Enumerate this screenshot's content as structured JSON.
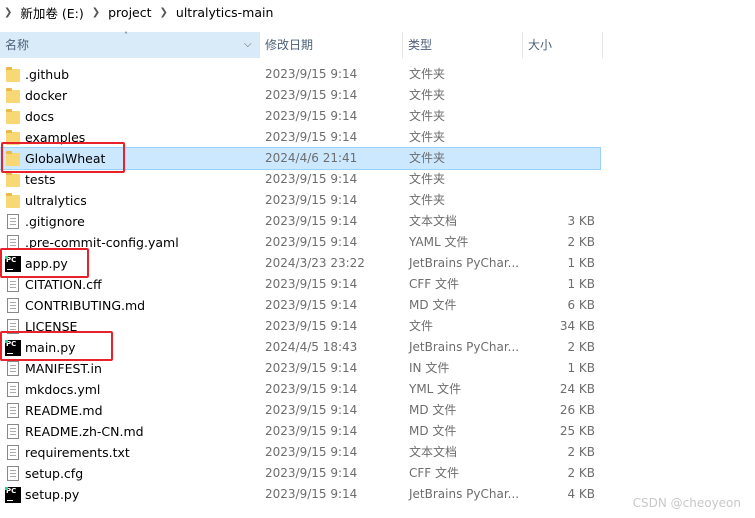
{
  "breadcrumb": [
    "新加卷 (E:)",
    "project",
    "ultralytics-main"
  ],
  "columns": {
    "name": "名称",
    "date": "修改日期",
    "type": "类型",
    "size": "大小"
  },
  "files": [
    {
      "name": ".github",
      "date": "2023/9/15 9:14",
      "type": "文件夹",
      "size": "",
      "icon": "folder-icon"
    },
    {
      "name": "docker",
      "date": "2023/9/15 9:14",
      "type": "文件夹",
      "size": "",
      "icon": "folder-icon"
    },
    {
      "name": "docs",
      "date": "2023/9/15 9:14",
      "type": "文件夹",
      "size": "",
      "icon": "folder-icon"
    },
    {
      "name": "examples",
      "date": "2023/9/15 9:14",
      "type": "文件夹",
      "size": "",
      "icon": "folder-icon"
    },
    {
      "name": "GlobalWheat",
      "date": "2024/4/6 21:41",
      "type": "文件夹",
      "size": "",
      "icon": "folder-icon",
      "selected": true
    },
    {
      "name": "tests",
      "date": "2023/9/15 9:14",
      "type": "文件夹",
      "size": "",
      "icon": "folder-icon"
    },
    {
      "name": "ultralytics",
      "date": "2023/9/15 9:14",
      "type": "文件夹",
      "size": "",
      "icon": "folder-icon"
    },
    {
      "name": ".gitignore",
      "date": "2023/9/15 9:14",
      "type": "文本文档",
      "size": "3 KB",
      "icon": "text-file-icon"
    },
    {
      "name": ".pre-commit-config.yaml",
      "date": "2023/9/15 9:14",
      "type": "YAML 文件",
      "size": "2 KB",
      "icon": "text-file-icon"
    },
    {
      "name": "app.py",
      "date": "2024/3/23 23:22",
      "type": "JetBrains PyChar...",
      "size": "1 KB",
      "icon": "pycharm-file-icon"
    },
    {
      "name": "CITATION.cff",
      "date": "2023/9/15 9:14",
      "type": "CFF 文件",
      "size": "1 KB",
      "icon": "text-file-icon"
    },
    {
      "name": "CONTRIBUTING.md",
      "date": "2023/9/15 9:14",
      "type": "MD 文件",
      "size": "6 KB",
      "icon": "text-file-icon"
    },
    {
      "name": "LICENSE",
      "date": "2023/9/15 9:14",
      "type": "文件",
      "size": "34 KB",
      "icon": "text-file-icon"
    },
    {
      "name": "main.py",
      "date": "2024/4/5 18:43",
      "type": "JetBrains PyChar...",
      "size": "2 KB",
      "icon": "pycharm-file-icon"
    },
    {
      "name": "MANIFEST.in",
      "date": "2023/9/15 9:14",
      "type": "IN 文件",
      "size": "1 KB",
      "icon": "text-file-icon"
    },
    {
      "name": "mkdocs.yml",
      "date": "2023/9/15 9:14",
      "type": "YML 文件",
      "size": "24 KB",
      "icon": "text-file-icon"
    },
    {
      "name": "README.md",
      "date": "2023/9/15 9:14",
      "type": "MD 文件",
      "size": "26 KB",
      "icon": "text-file-icon"
    },
    {
      "name": "README.zh-CN.md",
      "date": "2023/9/15 9:14",
      "type": "MD 文件",
      "size": "25 KB",
      "icon": "text-file-icon"
    },
    {
      "name": "requirements.txt",
      "date": "2023/9/15 9:14",
      "type": "文本文档",
      "size": "2 KB",
      "icon": "text-file-icon"
    },
    {
      "name": "setup.cfg",
      "date": "2023/9/15 9:14",
      "type": "CFF 文件",
      "size": "2 KB",
      "icon": "text-file-icon"
    },
    {
      "name": "setup.py",
      "date": "2023/9/15 9:14",
      "type": "JetBrains PyChar...",
      "size": "4 KB",
      "icon": "pycharm-file-icon"
    }
  ],
  "watermark": "CSDN @cheoyeon",
  "colors": {
    "selected_row": "#cce8ff",
    "highlight_box": "#e8212b",
    "folder": "#f8d775"
  }
}
